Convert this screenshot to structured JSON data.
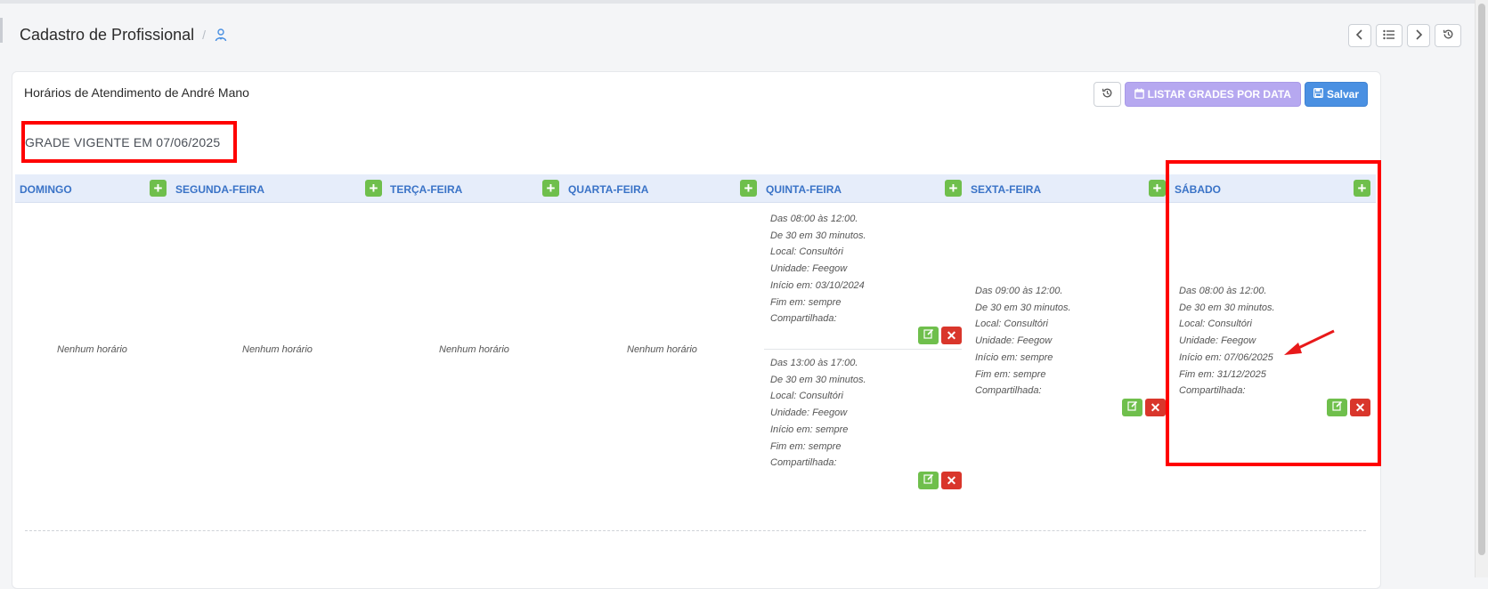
{
  "page": {
    "title": "Cadastro de Profissional",
    "breadcrumb_sep": "/",
    "breadcrumb_icon": "user-doctor-icon"
  },
  "nav": {
    "prev_icon": "chevron-left-icon",
    "list_icon": "list-icon",
    "next_icon": "chevron-right-icon",
    "history_icon": "history-icon"
  },
  "panel": {
    "title": "Horários de Atendimento de André Mano",
    "history_icon": "history-icon",
    "list_grades_label": "LISTAR GRADES POR DATA",
    "save_label": "Salvar",
    "colors": {
      "list_btn": "#b6a8f0",
      "save_btn": "#4a90e2",
      "add_btn": "#6fbf4c",
      "delete_btn": "#d9362b",
      "highlight": "#ff0000"
    }
  },
  "grade": {
    "title": "GRADE VIGENTE EM 07/06/2025"
  },
  "days": [
    {
      "name": "DOMINGO",
      "empty": "Nenhum horário",
      "slots": []
    },
    {
      "name": "SEGUNDA-FEIRA",
      "empty": "Nenhum horário",
      "slots": []
    },
    {
      "name": "TERÇA-FEIRA",
      "empty": "Nenhum horário",
      "slots": []
    },
    {
      "name": "QUARTA-FEIRA",
      "empty": "Nenhum horário",
      "slots": []
    },
    {
      "name": "QUINTA-FEIRA",
      "slots": [
        {
          "lines": [
            "Das 08:00 às 12:00.",
            "De 30 em 30 minutos.",
            "Local: Consultóri",
            "Unidade: Feegow",
            "Início em: 03/10/2024",
            "Fim em: sempre",
            "Compartilhada:"
          ]
        },
        {
          "lines": [
            "Das 13:00 às 17:00.",
            "De 30 em 30 minutos.",
            "Local: Consultóri",
            "Unidade: Feegow",
            "Início em: sempre",
            "Fim em: sempre",
            "Compartilhada:"
          ]
        }
      ]
    },
    {
      "name": "SEXTA-FEIRA",
      "slots": [
        {
          "lines": [
            "Das 09:00 às 12:00.",
            "De 30 em 30 minutos.",
            "Local: Consultóri",
            "Unidade: Feegow",
            "Início em: sempre",
            "Fim em: sempre",
            "Compartilhada:"
          ]
        }
      ]
    },
    {
      "name": "SÁBADO",
      "slots": [
        {
          "lines": [
            "Das 08:00 às 12:00.",
            "De 30 em 30 minutos.",
            "Local: Consultóri",
            "Unidade: Feegow",
            "Início em: 07/06/2025",
            "Fim em: 31/12/2025",
            "Compartilhada:"
          ]
        }
      ]
    }
  ],
  "actions": {
    "add_symbol": "+",
    "delete_symbol": "✕",
    "edit_icon": "edit-icon"
  }
}
